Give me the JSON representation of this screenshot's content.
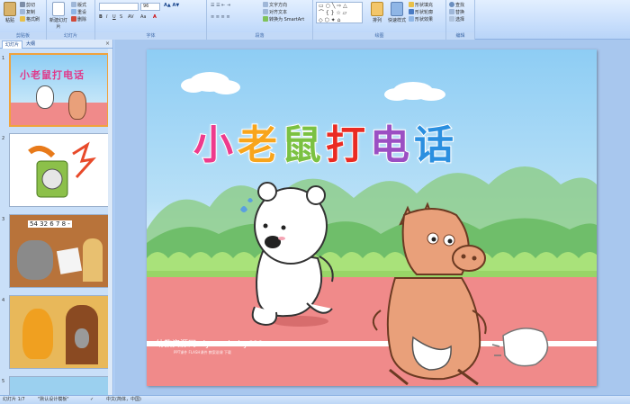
{
  "ribbon": {
    "clipboard": {
      "paste": "粘贴",
      "cut": "剪切",
      "copy": "复制",
      "format_painter": "格式刷",
      "group_label": "剪贴板"
    },
    "slides": {
      "new_slide": "新建幻灯片",
      "layout": "版式",
      "reset": "重设",
      "delete": "删除",
      "group_label": "幻灯片"
    },
    "font": {
      "font_size": "96",
      "group_label": "字体"
    },
    "paragraph": {
      "text_direction": "文字方向",
      "align_text": "对齐文本",
      "smartart": "转换为 SmartArt",
      "group_label": "段落"
    },
    "drawing": {
      "arrange": "排列",
      "quick_styles": "快速样式",
      "shape_fill": "形状填充",
      "shape_outline": "形状轮廓",
      "shape_effects": "形状效果",
      "group_label": "绘图"
    },
    "editing": {
      "find": "查找",
      "replace": "替换",
      "select": "选择",
      "group_label": "编辑"
    }
  },
  "panel": {
    "tabs": [
      "幻灯片",
      "大纲"
    ],
    "close": "×",
    "thumbnails": [
      {
        "number": "1",
        "title": "小老鼠打电话"
      },
      {
        "number": "2"
      },
      {
        "number": "3",
        "text": "54 32 6 7 8 -"
      },
      {
        "number": "4"
      },
      {
        "number": "5"
      }
    ]
  },
  "slide": {
    "title_chars": [
      {
        "ch": "小",
        "color": "#ee3b8c"
      },
      {
        "ch": "老",
        "color": "#f8a51c"
      },
      {
        "ch": "鼠",
        "color": "#7bc142"
      },
      {
        "ch": "打",
        "color": "#ea2b23"
      },
      {
        "ch": "电",
        "color": "#9b4fc3"
      },
      {
        "ch": "话",
        "color": "#2a8fe0"
      }
    ],
    "watermark": "幼教资源网 ziyuan.baby611.com",
    "watermark_small": "PPT课件 FLASH课件 教案说课 下载"
  },
  "status": {
    "slide_of": "幻灯片 1/7",
    "theme": "\"默认设计模板\"",
    "language": "中文(简体，中国)"
  },
  "colors": {
    "track": "#f08a8a",
    "grass": "#8fd35a",
    "hills": "#7ec56e",
    "accent": "#f0a23c"
  }
}
